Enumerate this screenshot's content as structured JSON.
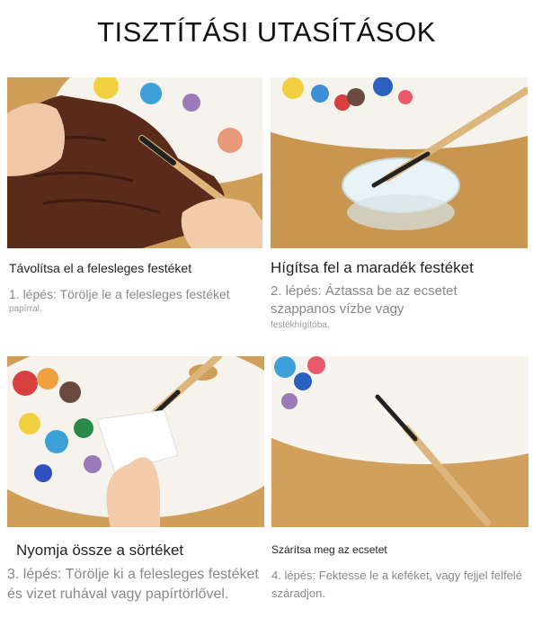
{
  "title": "TISZTÍTÁSI UTASÍTÁSOK",
  "steps": [
    {
      "heading": "Távolítsa el a felesleges festéket",
      "text": "1. lépés: Törölje le a felesleges festéket",
      "text_small": "papírral."
    },
    {
      "heading": "Hígítsa fel a maradék festéket",
      "text": "2. lépés: Áztassa be az ecsetet szappanos vízbe vagy",
      "text_small": "festékhígítóba."
    },
    {
      "heading": "Nyomja össze a sörtéket",
      "text": "3. lépés: Törölje ki a felesleges festéket és vizet ruhával vagy papírtörlővel."
    },
    {
      "heading": "Szárítsa meg az ecsetet",
      "text": "4. lépés: Fektesse le a keféket, vagy fejjel felfelé száradjon."
    }
  ],
  "colors": {
    "table": "#c9964f",
    "palette": "#f7f4ef",
    "brush_handle": "#dcb67c",
    "cloth": "#5a2a1a"
  }
}
